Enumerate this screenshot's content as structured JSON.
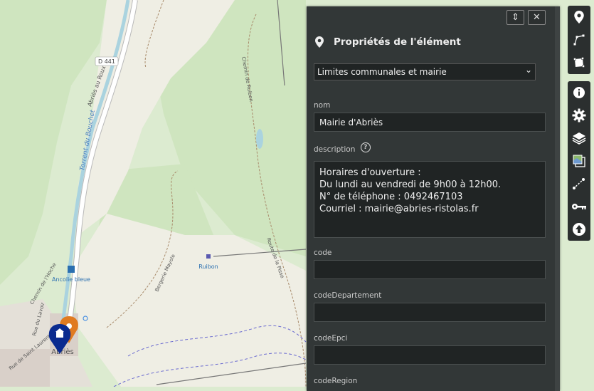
{
  "map": {
    "road_ref": "D 441",
    "street_labels": [
      "Abriès au Roux",
      "Torrent du Bouchet",
      "Chemin de l'Hoche",
      "Rue du Lavoir",
      "Rue de Saint Laurent",
      "Chemin de Ruibon",
      "Route de la Pisse",
      "Chemin de Ruibon"
    ],
    "poi_labels": [
      "Ancolie bleue",
      "Ruibon",
      "Abriès",
      "Bergerie Mayole"
    ],
    "town_label": "Abriès"
  },
  "panel": {
    "title": "Propriétés de l'élément",
    "layer_select": "Limites communales et mairie",
    "fields": [
      {
        "label": "nom",
        "value": "Mairie d'Abriès"
      },
      {
        "label": "description",
        "value": "Horaires d'ouverture :\nDu lundi au vendredi de 9h00 à 12h00.\nN° de téléphone : 0492467103\nCourriel : mairie@abries-ristolas.fr"
      },
      {
        "label": "code",
        "value": ""
      },
      {
        "label": "codeDepartement",
        "value": ""
      },
      {
        "label": "codeEpci",
        "value": ""
      },
      {
        "label": "codeRegion",
        "value": ""
      }
    ],
    "help_symbol": "?",
    "minimize_symbol": "⇕",
    "close_symbol": "✕",
    "select_chevron": "⌄"
  },
  "toolbar_top": [
    "marker-icon",
    "polyline-icon",
    "polygon-icon"
  ],
  "toolbar_bottom": [
    "info-icon",
    "settings-gear-icon",
    "layers-icon",
    "tile-layer-icon",
    "measure-icon",
    "key-icon",
    "upload-icon"
  ],
  "colors": {
    "panel_bg": "#323737",
    "map_bg": "#dcebd0",
    "road_white": "#ffffff",
    "water": "#aad3df",
    "marker_blue": "#0a2a8f",
    "marker_orange": "#e07b20"
  }
}
